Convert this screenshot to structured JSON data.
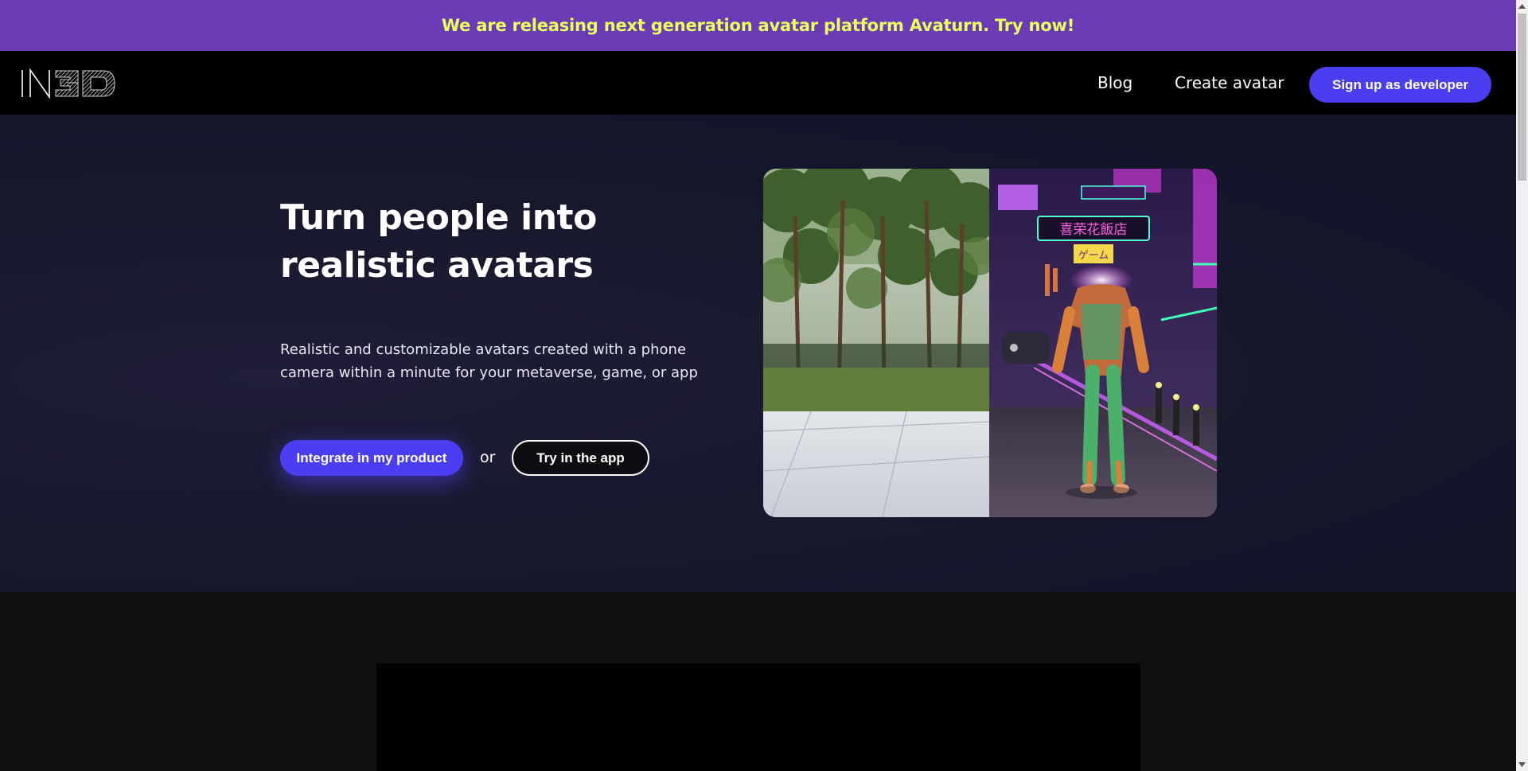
{
  "promo": {
    "text": "We are releasing next generation avatar platform Avaturn. Try now!"
  },
  "nav": {
    "logo_text": "IN3D",
    "links": [
      {
        "label": "Blog"
      },
      {
        "label": "Create avatar"
      }
    ],
    "cta_label": "Sign up as developer"
  },
  "hero": {
    "title": "Turn people into realistic avatars",
    "subtitle": "Realistic and customizable avatars created with a phone camera within a minute for your metaverse, game, or app",
    "primary_button": "Integrate in my product",
    "or_text": "or",
    "secondary_button": "Try in the app",
    "image": {
      "left_scene": "park with trees and reflective pavement",
      "right_scene": "neon city street with 3D avatar",
      "sign_texts": [
        "喜荣花飯店",
        "ゲーム"
      ]
    }
  },
  "colors": {
    "promo_bg": "#6a3bb5",
    "promo_text": "#e9ff5e",
    "nav_bg": "#000000",
    "accent": "#4a3ef0",
    "hero_bg": "#16182c",
    "lower_bg": "#0f0f10"
  }
}
